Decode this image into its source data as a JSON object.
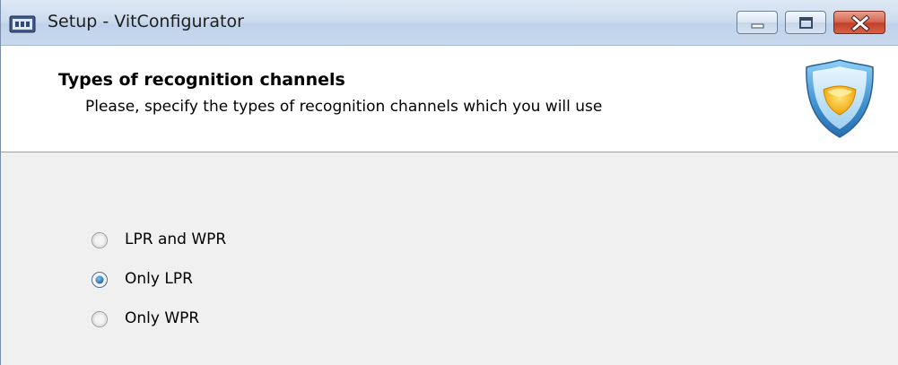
{
  "window": {
    "title": "Setup - VitConfigurator"
  },
  "header": {
    "title": "Types of recognition channels",
    "subtitle": "Please, specify the types of recognition channels which you will use"
  },
  "options": [
    {
      "label": "LPR and WPR",
      "selected": false
    },
    {
      "label": "Only LPR",
      "selected": true
    },
    {
      "label": "Only WPR",
      "selected": false
    }
  ],
  "colors": {
    "radio_selected": "#1d6fb8",
    "shield_accent": "#f6b400"
  }
}
